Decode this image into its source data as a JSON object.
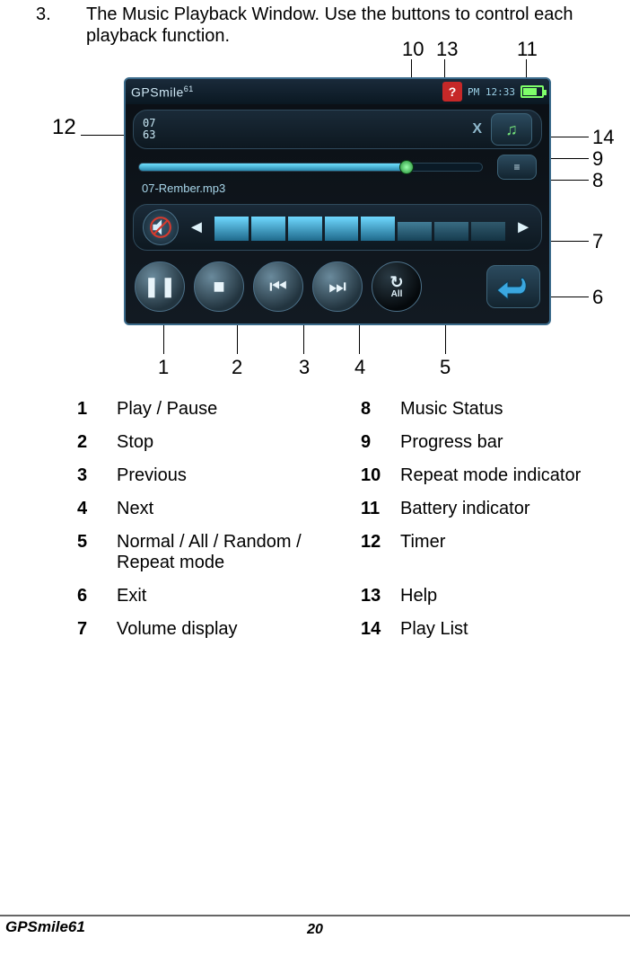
{
  "intro": {
    "num": "3.",
    "text": "The Music Playback Window. Use the buttons to control each playback function."
  },
  "topCallouts": {
    "c10": "10",
    "c13": "13",
    "c11": "11"
  },
  "leftCallout": "12",
  "rightCallouts": {
    "r14": "14",
    "r9": "9",
    "r8": "8",
    "r7": "7",
    "r6": "6"
  },
  "bottomCallouts": {
    "b1": "1",
    "b2": "2",
    "b3": "3",
    "b4": "4",
    "b5": "5"
  },
  "device": {
    "logo": "GPSmil",
    "logoSuffix": "e",
    "logoSup": "61",
    "help": "?",
    "time": "PM 12:33",
    "timerTop": "07",
    "timerBottom": "63",
    "xicon": "X",
    "playlistGlyph": "♫",
    "statusGlyph": "≡",
    "track": "07-Rember.mp3",
    "volDown": "◄",
    "volUp": "►",
    "pause": "❚❚",
    "stop": "■",
    "prev": "⏮",
    "next": "⏭",
    "repeatArrow": "↻",
    "repeatText": "All"
  },
  "legend": [
    [
      {
        "n": "1",
        "t": "Play / Pause"
      },
      {
        "n": "8",
        "t": "Music Status"
      }
    ],
    [
      {
        "n": "2",
        "t": "Stop"
      },
      {
        "n": "9",
        "t": "Progress bar"
      }
    ],
    [
      {
        "n": "3",
        "t": "Previous"
      },
      {
        "n": "10",
        "t": "Repeat mode indicator"
      }
    ],
    [
      {
        "n": "4",
        "t": "Next"
      },
      {
        "n": "11",
        "t": "Battery indicator"
      }
    ],
    [
      {
        "n": "5",
        "t": "Normal / All / Random / Repeat mode"
      },
      {
        "n": "12",
        "t": "Timer"
      }
    ],
    [
      {
        "n": "6",
        "t": "Exit"
      },
      {
        "n": "13",
        "t": "Help"
      }
    ],
    [
      {
        "n": "7",
        "t": "Volume display"
      },
      {
        "n": "14",
        "t": "Play List"
      }
    ]
  ],
  "footer": {
    "left": "GPSmile61",
    "center": "20"
  }
}
